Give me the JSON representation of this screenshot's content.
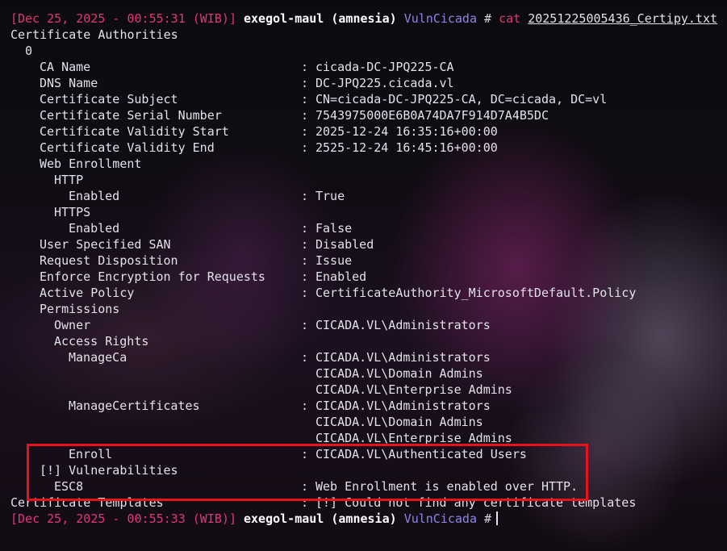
{
  "prompt": {
    "open_bracket": "[",
    "datetime": "Dec 25, 2025 - 00:55:31 (WIB)",
    "close_bracket": "]",
    "user_host": "exegol-maul (amnesia)",
    "directory": "VulnCicada",
    "hash": "#",
    "command": "cat",
    "file": "20251225005436_Certipy.txt"
  },
  "prompt_end": {
    "open_bracket": "[",
    "datetime": "Dec 25, 2025 - 00:55:33 (WIB)",
    "close_bracket": "]",
    "user_host": "exegol-maul (amnesia)",
    "directory": "VulnCicada",
    "hash": "#"
  },
  "output": {
    "section_ca": "Certificate Authorities",
    "index": "0",
    "separator": ":",
    "rows": [
      {
        "key": "CA Name",
        "value": "cicada-DC-JPQ225-CA"
      },
      {
        "key": "DNS Name",
        "value": "DC-JPQ225.cicada.vl"
      },
      {
        "key": "Certificate Subject",
        "value": "CN=cicada-DC-JPQ225-CA, DC=cicada, DC=vl"
      },
      {
        "key": "Certificate Serial Number",
        "value": "7543975000E6B0A74DA7F914D7A4B5DC"
      },
      {
        "key": "Certificate Validity Start",
        "value": "2025-12-24 16:35:16+00:00"
      },
      {
        "key": "Certificate Validity End",
        "value": "2525-12-24 16:45:16+00:00"
      }
    ],
    "web_enrollment": "Web Enrollment",
    "http": "HTTP",
    "http_enabled_key": "Enabled",
    "http_enabled_value": "True",
    "https": "HTTPS",
    "https_enabled_key": "Enabled",
    "https_enabled_value": "False",
    "rows2": [
      {
        "key": "User Specified SAN",
        "value": "Disabled"
      },
      {
        "key": "Request Disposition",
        "value": "Issue"
      },
      {
        "key": "Enforce Encryption for Requests",
        "value": "Enabled"
      },
      {
        "key": "Active Policy",
        "value": "CertificateAuthority_MicrosoftDefault.Policy"
      }
    ],
    "permissions": "Permissions",
    "owner_key": "Owner",
    "owner_value": "CICADA.VL\\Administrators",
    "access_rights": "Access Rights",
    "manage_ca_key": "ManageCa",
    "manage_ca_values": [
      "CICADA.VL\\Administrators",
      "CICADA.VL\\Domain Admins",
      "CICADA.VL\\Enterprise Admins"
    ],
    "manage_certs_key": "ManageCertificates",
    "manage_certs_values": [
      "CICADA.VL\\Administrators",
      "CICADA.VL\\Domain Admins",
      "CICADA.VL\\Enterprise Admins"
    ],
    "enroll_key": "Enroll",
    "enroll_value": "CICADA.VL\\Authenticated Users",
    "vulnerabilities": "[!] Vulnerabilities",
    "esc8_key": "ESC8",
    "esc8_value": "Web Enrollment is enabled over HTTP.",
    "templates_key": "Certificate Templates",
    "templates_value": "[!] Could not find any certificate templates"
  },
  "colors": {
    "prompt_accent": "#e4357a",
    "directory": "#8e86e6",
    "text": "#e3e1ea",
    "highlight_box": "#e8121a"
  }
}
